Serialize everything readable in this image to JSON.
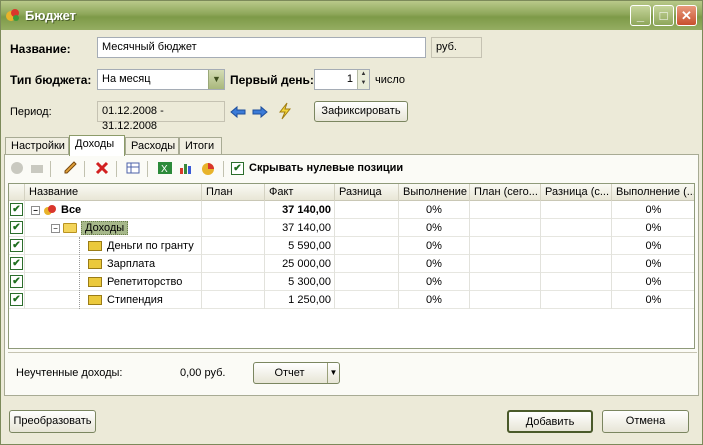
{
  "window": {
    "title": "Бюджет"
  },
  "form": {
    "name_label": "Название:",
    "name_value": "Месячный бюджет",
    "currency": "руб.",
    "type_label": "Тип бюджета:",
    "type_value": "На месяц",
    "first_day_label": "Первый день:",
    "first_day_value": "1",
    "first_day_unit": "число",
    "period_label": "Период:",
    "period_value": "01.12.2008 - 31.12.2008",
    "fix_button": "Зафиксировать"
  },
  "tabs": [
    "Настройки",
    "Доходы",
    "Расходы",
    "Итоги"
  ],
  "active_tab": "Доходы",
  "toolbar": {
    "hide_zero_label": "Скрывать нулевые позиции",
    "hide_zero_checked": true
  },
  "grid": {
    "headers": [
      "Название",
      "План",
      "Факт",
      "Разница",
      "Выполнение",
      "План (сего...",
      "Разница (с...",
      "Выполнение (..."
    ],
    "rows": [
      {
        "name": "Все",
        "plan": "",
        "fact": "37 140,00",
        "diff": "",
        "perf": "0%",
        "plan_today": "",
        "diff_today": "",
        "perf_today": "0%"
      },
      {
        "name": "Доходы",
        "plan": "",
        "fact": "37 140,00",
        "diff": "",
        "perf": "0%",
        "plan_today": "",
        "diff_today": "",
        "perf_today": "0%"
      },
      {
        "name": "Деньги по гранту",
        "plan": "",
        "fact": "5 590,00",
        "diff": "",
        "perf": "0%",
        "plan_today": "",
        "diff_today": "",
        "perf_today": "0%"
      },
      {
        "name": "Зарплата",
        "plan": "",
        "fact": "25 000,00",
        "diff": "",
        "perf": "0%",
        "plan_today": "",
        "diff_today": "",
        "perf_today": "0%"
      },
      {
        "name": "Репетиторство",
        "plan": "",
        "fact": "5 300,00",
        "diff": "",
        "perf": "0%",
        "plan_today": "",
        "diff_today": "",
        "perf_today": "0%"
      },
      {
        "name": "Стипендия",
        "plan": "",
        "fact": "1 250,00",
        "diff": "",
        "perf": "0%",
        "plan_today": "",
        "diff_today": "",
        "perf_today": "0%"
      }
    ]
  },
  "status": {
    "unaccounted_label": "Неучтенные доходы:",
    "unaccounted_value": "0,00 руб.",
    "report_button": "Отчет"
  },
  "footer": {
    "convert_button": "Преобразовать",
    "add_button": "Добавить",
    "cancel_button": "Отмена"
  }
}
